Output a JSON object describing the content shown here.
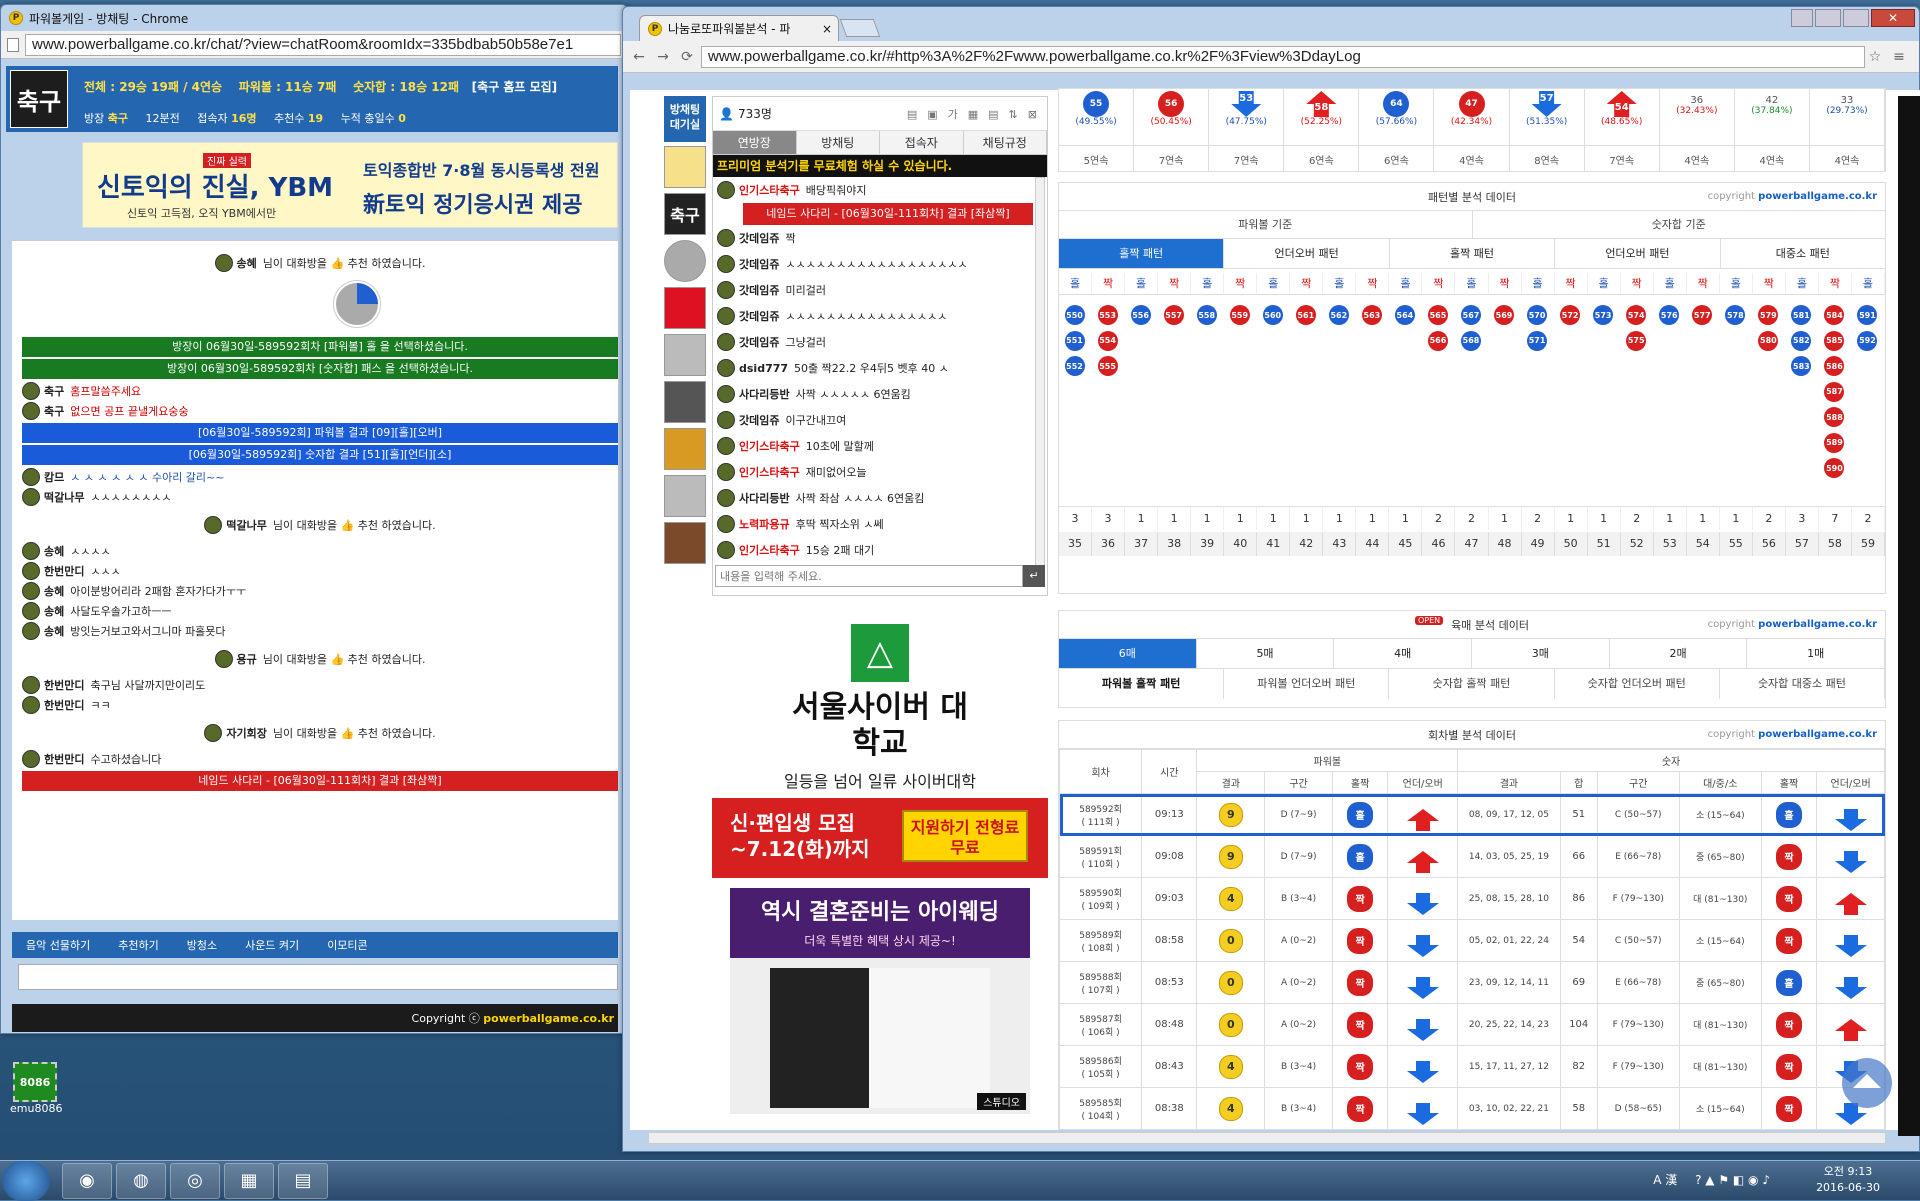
{
  "left_window": {
    "title": "파워볼게임 - 방채팅 - Chrome",
    "url": "www.powerballgame.co.kr/chat/?view=chatRoom&roomIdx=335bdbab50b58e7e1",
    "logo": "축구",
    "stats_line": "전체 : 29승 19패 / 4연승",
    "stats_powerball": "파워볼 : 11승 7패",
    "stats_sum": "숫자합 : 18승 12패",
    "stats_room": "[축구 홈프 모집]",
    "host_label": "방장",
    "host": "축구",
    "rounds": "12분전",
    "users_label": "접속자",
    "users": "16명",
    "recommend_label": "추천수",
    "recommend": "19",
    "days_label": "누적 충일수",
    "days": "0",
    "ad_text1": "신토익의 진실, YBM",
    "ad_text2": "신토익 고득점, 오직 YBM에서만",
    "ad_text3": "토익종합반  7·8월 동시등록생 전원",
    "ad_text4": "新토익 정기응시권 제공",
    "ad_tag": "진짜 실력",
    "footer": [
      "음악 선물하기",
      "추천하기",
      "방청소",
      "사운드 켜기",
      "이모티콘"
    ],
    "copyright_prefix": "Copyright ⓒ",
    "copyright_site": "powerballgame.co.kr",
    "chat": {
      "recommend1": {
        "nick": "송혜",
        "text": "님이 대화방을 👍 추천 하였습니다."
      },
      "pick1": "방장이 06월30일-589592회차 [파워볼] 홀 을 선택하셨습니다.",
      "pick2": "방장이 06월30일-589592회차 [숫자합] 패스 을 선택하셨습니다.",
      "msgs1": [
        {
          "nick": "축구",
          "text": "홈프말씀주세요"
        },
        {
          "nick": "축구",
          "text": "없으면 공프 끝낼게요숭숭"
        }
      ],
      "res1": "[06월30일-589592회] 파워볼 결과 [09][홀][오버]",
      "res2": "[06월30일-589592회] 숫자합 결과 [51][홀][언더][소]",
      "msgs2": [
        {
          "nick": "캄므",
          "text": "ㅅ ㅅ ㅅ ㅅ ㅅ ㅅ 수아리 갈리~~"
        },
        {
          "nick": "떡갈나무",
          "text": "ㅅㅅㅅㅅㅅㅅㅅㅅ"
        }
      ],
      "recommend2": {
        "nick": "떡갈나무",
        "text": "님이 대화방을 👍 추천 하였습니다."
      },
      "msgs3": [
        {
          "nick": "송혜",
          "text": "ㅅㅅㅅㅅ"
        },
        {
          "nick": "한번만디",
          "text": "ㅅㅅㅅ"
        },
        {
          "nick": "송혜",
          "text": "아이분방어리라 2패함 혼자가다가ㅜㅜ"
        },
        {
          "nick": "송혜",
          "text": "사달도우솔가고하ㅡㅡ"
        },
        {
          "nick": "송혜",
          "text": "방잇는거보고와서그니마 파홀묫다"
        }
      ],
      "recommend3": {
        "nick": "용규",
        "text": "님이 대화방을 👍 추천 하였습니다."
      },
      "msgs4": [
        {
          "nick": "한번만디",
          "text": "축구님 사달까지만이리도"
        },
        {
          "nick": "한번만디",
          "text": "ㅋㅋ"
        }
      ],
      "recommend4": {
        "nick": "자기회장",
        "text": "님이 대화방을 👍 추천 하였습니다."
      },
      "msgs5": [
        {
          "nick": "한번만디",
          "text": "수고하셨습니다"
        }
      ],
      "ladder": "네임드 사다리 - [06월30일-111회차] 결과 [좌삼짝]"
    }
  },
  "right_window": {
    "tab_title": "나눔로또파워볼분석 - 파",
    "url": "www.powerballgame.co.kr/#http%3A%2F%2Fwww.powerballgame.co.kr%2F%3Fview%3DdayLog",
    "side_title": "방채팅 대기실",
    "chat_count": "733명",
    "chat_tabs": [
      "연방장",
      "방채팅",
      "접속자",
      "채팅규정"
    ],
    "promo": "프리미엄 분석기를 무료체험 하실 수 있습니다.",
    "chat_msgs": [
      {
        "nick": "인기스타축구",
        "text": "배당픽줘야지",
        "red": true
      },
      {
        "nick": "__LADDER__",
        "text": "네임드 사다리 - [06월30일-111회차] 결과 [좌삼짝]"
      },
      {
        "nick": "갓데임쥬",
        "text": "짝"
      },
      {
        "nick": "갓데임쥬",
        "text": "ㅅㅅㅅㅅㅅㅅㅅㅅㅅㅅㅅㅅㅅㅅㅅㅅㅅㅅ"
      },
      {
        "nick": "갓데임쥬",
        "text": "미리걸러"
      },
      {
        "nick": "갓데임쥬",
        "text": "ㅅㅅㅅㅅㅅㅅㅅㅅㅅㅅㅅㅅㅅㅅㅅㅅ"
      },
      {
        "nick": "갓데임쥬",
        "text": "그냥걸러"
      },
      {
        "nick": "dsid777",
        "text": "50출 짝22.2 우4뒤5 벳후 40 ㅅ"
      },
      {
        "nick": "사다리등반",
        "text": "사짝 ㅅㅅㅅㅅㅅ 6연움킴"
      },
      {
        "nick": "갓데임쥬",
        "text": "이구간내끄여"
      },
      {
        "nick": "인기스타축구",
        "text": "10초에 말할께",
        "red": true
      },
      {
        "nick": "인기스타축구",
        "text": "재미없어오늘",
        "red": true
      },
      {
        "nick": "사다리등반",
        "text": "사짝 좌삼 ㅅㅅㅅㅅ 6연움킴"
      },
      {
        "nick": "노력파용규",
        "text": "후딱 찍자소위 ㅅ쎄",
        "red": true
      },
      {
        "nick": "인기스타축구",
        "text": "15승 2패 대기",
        "red": true
      }
    ],
    "chat_placeholder": "내용을 입력해 주세요.",
    "ad_uni": "서울사이버 대학교",
    "ad_uni_sub": "일등을 넘어 일류 사이버대학",
    "ad_recruit": "신·편입생 모집 ~7.12(화)까지",
    "ad_apply": "지원하기 전형료무료",
    "ad_wed": "역시 결혼준비는 아이웨딩",
    "ad_wed_sub": "더욱 특별한 혜택 상시 제공~!",
    "ad_studio": "스튜디오",
    "top_stats": [
      {
        "v": "55",
        "pct": "(49.55%)",
        "streak": "5연속",
        "c": "blue"
      },
      {
        "v": "56",
        "pct": "(50.45%)",
        "streak": "7연속",
        "c": "red"
      },
      {
        "v": "53",
        "pct": "(47.75%)",
        "streak": "7연속",
        "c": "bdown"
      },
      {
        "v": "58",
        "pct": "(52.25%)",
        "streak": "6연속",
        "c": "rup"
      },
      {
        "v": "64",
        "pct": "(57.66%)",
        "streak": "6연속",
        "c": "blue"
      },
      {
        "v": "47",
        "pct": "(42.34%)",
        "streak": "4연속",
        "c": "red"
      },
      {
        "v": "57",
        "pct": "(51.35%)",
        "streak": "8연속",
        "c": "bdown"
      },
      {
        "v": "54",
        "pct": "(48.65%)",
        "streak": "7연속",
        "c": "rup"
      },
      {
        "v": "36",
        "pct": "(32.43%)",
        "streak": "4연속",
        "c": "txt"
      },
      {
        "v": "42",
        "pct": "(37.84%)",
        "streak": "4연속",
        "c": "txt"
      },
      {
        "v": "33",
        "pct": "(29.73%)",
        "streak": "4연속",
        "c": "txt"
      }
    ],
    "pattern_title": "패턴별 분석 데이터",
    "copyright": "copyright",
    "copyright_site": "powerballgame.co.kr",
    "pattern_groups": [
      "파워볼 기준",
      "숫자합 기준"
    ],
    "pattern_tabs": [
      "홀짝 패턴",
      "언더오버 패턴",
      "홀짝 패턴",
      "언더오버 패턴",
      "대중소 패턴"
    ],
    "oe_headers": [
      "홀",
      "짝"
    ],
    "pattern_cols": [
      {
        "c": "b",
        "n": [
          "550",
          "551",
          "552"
        ]
      },
      {
        "c": "r",
        "n": [
          "553",
          "554",
          "555"
        ]
      },
      {
        "c": "b",
        "n": [
          "556"
        ]
      },
      {
        "c": "r",
        "n": [
          "557"
        ]
      },
      {
        "c": "b",
        "n": [
          "558"
        ]
      },
      {
        "c": "r",
        "n": [
          "559"
        ]
      },
      {
        "c": "b",
        "n": [
          "560"
        ]
      },
      {
        "c": "r",
        "n": [
          "561"
        ]
      },
      {
        "c": "b",
        "n": [
          "562"
        ]
      },
      {
        "c": "r",
        "n": [
          "563"
        ]
      },
      {
        "c": "b",
        "n": [
          "564"
        ]
      },
      {
        "c": "r",
        "n": [
          "565",
          "566"
        ]
      },
      {
        "c": "b",
        "n": [
          "567",
          "568"
        ]
      },
      {
        "c": "r",
        "n": [
          "569"
        ]
      },
      {
        "c": "b",
        "n": [
          "570",
          "571"
        ]
      },
      {
        "c": "r",
        "n": [
          "572"
        ]
      },
      {
        "c": "b",
        "n": [
          "573"
        ]
      },
      {
        "c": "r",
        "n": [
          "574",
          "575"
        ]
      },
      {
        "c": "b",
        "n": [
          "576"
        ]
      },
      {
        "c": "r",
        "n": [
          "577"
        ]
      },
      {
        "c": "b",
        "n": [
          "578"
        ]
      },
      {
        "c": "r",
        "n": [
          "579",
          "580"
        ]
      },
      {
        "c": "b",
        "n": [
          "581",
          "582",
          "583"
        ]
      },
      {
        "c": "r",
        "n": [
          "584",
          "585",
          "586",
          "587",
          "588",
          "589",
          "590"
        ]
      },
      {
        "c": "b",
        "n": [
          "591",
          "592"
        ]
      }
    ],
    "pattern_counts": [
      "3",
      "3",
      "1",
      "1",
      "1",
      "1",
      "1",
      "1",
      "1",
      "1",
      "1",
      "2",
      "2",
      "1",
      "2",
      "1",
      "1",
      "2",
      "1",
      "1",
      "1",
      "2",
      "3",
      "7",
      "2"
    ],
    "pattern_index": [
      "35",
      "36",
      "37",
      "38",
      "39",
      "40",
      "41",
      "42",
      "43",
      "44",
      "45",
      "46",
      "47",
      "48",
      "49",
      "50",
      "51",
      "52",
      "53",
      "54",
      "55",
      "56",
      "57",
      "58",
      "59"
    ],
    "six_title": "육매 분석 데이터",
    "open_badge": "OPEN",
    "six_tabs": [
      "6매",
      "5매",
      "4매",
      "3매",
      "2매",
      "1매"
    ],
    "six_subtabs": [
      "파워볼 홀짝 패턴",
      "파워볼 언더오버 패턴",
      "숫자합 홀짝 패턴",
      "숫자합 언더오버 패턴",
      "숫자합 대중소 패턴"
    ],
    "round_title": "회차별 분석 데이터",
    "round_headers": {
      "round": "회차",
      "time": "시간",
      "powerball": "파워볼",
      "numbers": "숫자",
      "result": "결과",
      "section": "구간",
      "oe": "홀짝",
      "uo": "언더/오버",
      "sum": "합",
      "size": "대/중/소"
    },
    "rounds": [
      {
        "id": "589592회",
        "sub": "( 111회 )",
        "time": "09:13",
        "pb": "9",
        "pbsec": "D (7~9)",
        "pboe": "홀",
        "pbuo": "up",
        "nums": "08, 09, 17, 12, 05",
        "sum": "51",
        "sec": "C (50~57)",
        "size": "소 (15~64)",
        "oe": "홀",
        "uo": "down",
        "hl": true
      },
      {
        "id": "589591회",
        "sub": "( 110회 )",
        "time": "09:08",
        "pb": "9",
        "pbsec": "D (7~9)",
        "pboe": "홀",
        "pbuo": "up",
        "nums": "14, 03, 05, 25, 19",
        "sum": "66",
        "sec": "E (66~78)",
        "size": "중 (65~80)",
        "oe": "짝",
        "uo": "down"
      },
      {
        "id": "589590회",
        "sub": "( 109회 )",
        "time": "09:03",
        "pb": "4",
        "pbsec": "B (3~4)",
        "pboe": "짝",
        "pbuo": "down",
        "nums": "25, 08, 15, 28, 10",
        "sum": "86",
        "sec": "F (79~130)",
        "size": "대 (81~130)",
        "oe": "짝",
        "uo": "up"
      },
      {
        "id": "589589회",
        "sub": "( 108회 )",
        "time": "08:58",
        "pb": "0",
        "pbsec": "A (0~2)",
        "pboe": "짝",
        "pbuo": "down",
        "nums": "05, 02, 01, 22, 24",
        "sum": "54",
        "sec": "C (50~57)",
        "size": "소 (15~64)",
        "oe": "짝",
        "uo": "down"
      },
      {
        "id": "589588회",
        "sub": "( 107회 )",
        "time": "08:53",
        "pb": "0",
        "pbsec": "A (0~2)",
        "pboe": "짝",
        "pbuo": "down",
        "nums": "23, 09, 12, 14, 11",
        "sum": "69",
        "sec": "E (66~78)",
        "size": "중 (65~80)",
        "oe": "홀",
        "uo": "down"
      },
      {
        "id": "589587회",
        "sub": "( 106회 )",
        "time": "08:48",
        "pb": "0",
        "pbsec": "A (0~2)",
        "pboe": "짝",
        "pbuo": "down",
        "nums": "20, 25, 22, 14, 23",
        "sum": "104",
        "sec": "F (79~130)",
        "size": "대 (81~130)",
        "oe": "짝",
        "uo": "up"
      },
      {
        "id": "589586회",
        "sub": "( 105회 )",
        "time": "08:43",
        "pb": "4",
        "pbsec": "B (3~4)",
        "pboe": "짝",
        "pbuo": "down",
        "nums": "15, 17, 11, 27, 12",
        "sum": "82",
        "sec": "F (79~130)",
        "size": "대 (81~130)",
        "oe": "짝",
        "uo": "down"
      },
      {
        "id": "589585회",
        "sub": "( 104회 )",
        "time": "08:38",
        "pb": "4",
        "pbsec": "B (3~4)",
        "pboe": "짝",
        "pbuo": "down",
        "nums": "03, 10, 02, 22, 21",
        "sum": "58",
        "sec": "D (58~65)",
        "size": "소 (15~64)",
        "oe": "짝",
        "uo": "down"
      }
    ]
  },
  "desktop": {
    "icon_label": "emu8086",
    "icon_text": "8086"
  },
  "taskbar": {
    "time": "오전 9:13",
    "date": "2016-06-30",
    "lang": "A 漢"
  }
}
